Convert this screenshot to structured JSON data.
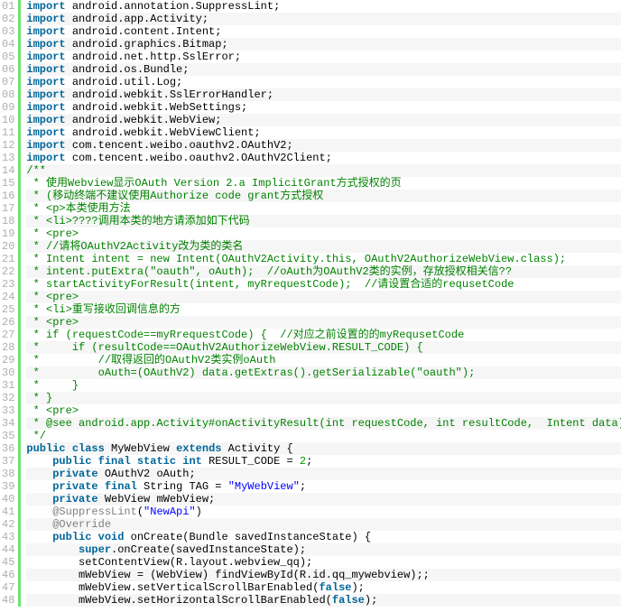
{
  "lines": [
    {
      "n": "01",
      "t": [
        {
          "c": "kw",
          "v": "import"
        },
        {
          "c": "pl",
          "v": " android.annotation.SuppressLint;"
        }
      ]
    },
    {
      "n": "02",
      "t": [
        {
          "c": "kw",
          "v": "import"
        },
        {
          "c": "pl",
          "v": " android.app.Activity;"
        }
      ]
    },
    {
      "n": "03",
      "t": [
        {
          "c": "kw",
          "v": "import"
        },
        {
          "c": "pl",
          "v": " android.content.Intent;"
        }
      ]
    },
    {
      "n": "04",
      "t": [
        {
          "c": "kw",
          "v": "import"
        },
        {
          "c": "pl",
          "v": " android.graphics.Bitmap;"
        }
      ]
    },
    {
      "n": "05",
      "t": [
        {
          "c": "kw",
          "v": "import"
        },
        {
          "c": "pl",
          "v": " android.net.http.SslError;"
        }
      ]
    },
    {
      "n": "06",
      "t": [
        {
          "c": "kw",
          "v": "import"
        },
        {
          "c": "pl",
          "v": " android.os.Bundle;"
        }
      ]
    },
    {
      "n": "07",
      "t": [
        {
          "c": "kw",
          "v": "import"
        },
        {
          "c": "pl",
          "v": " android.util.Log;"
        }
      ]
    },
    {
      "n": "08",
      "t": [
        {
          "c": "kw",
          "v": "import"
        },
        {
          "c": "pl",
          "v": " android.webkit.SslErrorHandler;"
        }
      ]
    },
    {
      "n": "09",
      "t": [
        {
          "c": "kw",
          "v": "import"
        },
        {
          "c": "pl",
          "v": " android.webkit.WebSettings;"
        }
      ]
    },
    {
      "n": "10",
      "t": [
        {
          "c": "kw",
          "v": "import"
        },
        {
          "c": "pl",
          "v": " android.webkit.WebView;"
        }
      ]
    },
    {
      "n": "11",
      "t": [
        {
          "c": "kw",
          "v": "import"
        },
        {
          "c": "pl",
          "v": " android.webkit.WebViewClient;"
        }
      ]
    },
    {
      "n": "12",
      "t": [
        {
          "c": "kw",
          "v": "import"
        },
        {
          "c": "pl",
          "v": " com.tencent.weibo.oauthv2.OAuthV2;"
        }
      ]
    },
    {
      "n": "13",
      "t": [
        {
          "c": "kw",
          "v": "import"
        },
        {
          "c": "pl",
          "v": " com.tencent.weibo.oauthv2.OAuthV2Client;"
        }
      ]
    },
    {
      "n": "14",
      "t": [
        {
          "c": "cm",
          "v": "/**"
        }
      ]
    },
    {
      "n": "15",
      "t": [
        {
          "c": "cm",
          "v": " * 使用Webview显示OAuth Version 2.a ImplicitGrant方式授权的页"
        }
      ]
    },
    {
      "n": "16",
      "t": [
        {
          "c": "cm",
          "v": " * (移动终端不建议使用Authorize code grant方式授权"
        }
      ]
    },
    {
      "n": "17",
      "t": [
        {
          "c": "cm",
          "v": " * <p>本类使用方法"
        }
      ]
    },
    {
      "n": "18",
      "t": [
        {
          "c": "cm",
          "v": " * <li>????调用本类的地方请添加如下代码"
        }
      ]
    },
    {
      "n": "19",
      "t": [
        {
          "c": "cm",
          "v": " * <pre>"
        }
      ]
    },
    {
      "n": "20",
      "t": [
        {
          "c": "cm",
          "v": " * //请将OAuthV2Activity改为类的类名"
        }
      ]
    },
    {
      "n": "21",
      "t": [
        {
          "c": "cm",
          "v": " * Intent intent = new Intent(OAuthV2Activity.this, OAuthV2AuthorizeWebView.class);"
        }
      ]
    },
    {
      "n": "22",
      "t": [
        {
          "c": "cm",
          "v": " * intent.putExtra(\"oauth\", oAuth);  //oAuth为OAuthV2类的实例，存放授权相关信??"
        }
      ]
    },
    {
      "n": "23",
      "t": [
        {
          "c": "cm",
          "v": " * startActivityForResult(intent, myRrequestCode);  //请设置合适的requsetCode"
        }
      ]
    },
    {
      "n": "24",
      "t": [
        {
          "c": "cm",
          "v": " * <pre>"
        }
      ]
    },
    {
      "n": "25",
      "t": [
        {
          "c": "cm",
          "v": " * <li>重写接收回调信息的方"
        }
      ]
    },
    {
      "n": "26",
      "t": [
        {
          "c": "cm",
          "v": " * <pre>"
        }
      ]
    },
    {
      "n": "27",
      "t": [
        {
          "c": "cm",
          "v": " * if (requestCode==myRrequestCode) {  //对应之前设置的的myRequsetCode"
        }
      ]
    },
    {
      "n": "28",
      "t": [
        {
          "c": "cm",
          "v": " *     if (resultCode==OAuthV2AuthorizeWebView.RESULT_CODE) {"
        }
      ]
    },
    {
      "n": "29",
      "t": [
        {
          "c": "cm",
          "v": " *         //取得返回的OAuthV2类实例oAuth"
        }
      ]
    },
    {
      "n": "30",
      "t": [
        {
          "c": "cm",
          "v": " *         oAuth=(OAuthV2) data.getExtras().getSerializable(\"oauth\");"
        }
      ]
    },
    {
      "n": "31",
      "t": [
        {
          "c": "cm",
          "v": " *     }"
        }
      ]
    },
    {
      "n": "32",
      "t": [
        {
          "c": "cm",
          "v": " * }"
        }
      ]
    },
    {
      "n": "33",
      "t": [
        {
          "c": "cm",
          "v": " * <pre>"
        }
      ]
    },
    {
      "n": "34",
      "t": [
        {
          "c": "cm",
          "v": " * @see android.app.Activity#onActivityResult(int requestCode, int resultCode,  Intent data)"
        }
      ]
    },
    {
      "n": "35",
      "t": [
        {
          "c": "cm",
          "v": " */"
        }
      ]
    },
    {
      "n": "36",
      "t": [
        {
          "c": "kw",
          "v": "public"
        },
        {
          "c": "pl",
          "v": " "
        },
        {
          "c": "kw",
          "v": "class"
        },
        {
          "c": "pl",
          "v": " MyWebView "
        },
        {
          "c": "kw",
          "v": "extends"
        },
        {
          "c": "pl",
          "v": " Activity {"
        }
      ]
    },
    {
      "n": "37",
      "t": [
        {
          "c": "pl",
          "v": "    "
        },
        {
          "c": "kw",
          "v": "public"
        },
        {
          "c": "pl",
          "v": " "
        },
        {
          "c": "kw",
          "v": "final"
        },
        {
          "c": "pl",
          "v": " "
        },
        {
          "c": "kw",
          "v": "static"
        },
        {
          "c": "pl",
          "v": " "
        },
        {
          "c": "kw",
          "v": "int"
        },
        {
          "c": "pl",
          "v": " RESULT_CODE = "
        },
        {
          "c": "num",
          "v": "2"
        },
        {
          "c": "pl",
          "v": ";"
        }
      ]
    },
    {
      "n": "38",
      "t": [
        {
          "c": "pl",
          "v": "    "
        },
        {
          "c": "kw",
          "v": "private"
        },
        {
          "c": "pl",
          "v": " OAuthV2 oAuth;"
        }
      ]
    },
    {
      "n": "39",
      "t": [
        {
          "c": "pl",
          "v": "    "
        },
        {
          "c": "kw",
          "v": "private"
        },
        {
          "c": "pl",
          "v": " "
        },
        {
          "c": "kw",
          "v": "final"
        },
        {
          "c": "pl",
          "v": " String TAG = "
        },
        {
          "c": "str",
          "v": "\"MyWebView\""
        },
        {
          "c": "pl",
          "v": ";"
        }
      ]
    },
    {
      "n": "40",
      "t": [
        {
          "c": "pl",
          "v": "    "
        },
        {
          "c": "kw",
          "v": "private"
        },
        {
          "c": "pl",
          "v": " WebView mWebView;"
        }
      ]
    },
    {
      "n": "41",
      "t": [
        {
          "c": "pl",
          "v": "    "
        },
        {
          "c": "ann",
          "v": "@SuppressLint"
        },
        {
          "c": "pl",
          "v": "("
        },
        {
          "c": "str",
          "v": "\"NewApi\""
        },
        {
          "c": "pl",
          "v": ")"
        }
      ]
    },
    {
      "n": "42",
      "t": [
        {
          "c": "pl",
          "v": "    "
        },
        {
          "c": "ann",
          "v": "@Override"
        }
      ]
    },
    {
      "n": "43",
      "t": [
        {
          "c": "pl",
          "v": "    "
        },
        {
          "c": "kw",
          "v": "public"
        },
        {
          "c": "pl",
          "v": " "
        },
        {
          "c": "kw",
          "v": "void"
        },
        {
          "c": "pl",
          "v": " onCreate(Bundle savedInstanceState) {"
        }
      ]
    },
    {
      "n": "44",
      "t": [
        {
          "c": "pl",
          "v": "        "
        },
        {
          "c": "kw",
          "v": "super"
        },
        {
          "c": "pl",
          "v": ".onCreate(savedInstanceState);"
        }
      ]
    },
    {
      "n": "45",
      "t": [
        {
          "c": "pl",
          "v": "        setContentView(R.layout.webview_qq);"
        }
      ]
    },
    {
      "n": "46",
      "t": [
        {
          "c": "pl",
          "v": "        mWebView = (WebView) findViewById(R.id.qq_mywebview);;"
        }
      ]
    },
    {
      "n": "47",
      "t": [
        {
          "c": "pl",
          "v": "        mWebView.setVerticalScrollBarEnabled("
        },
        {
          "c": "kw",
          "v": "false"
        },
        {
          "c": "pl",
          "v": ");"
        }
      ]
    },
    {
      "n": "48",
      "t": [
        {
          "c": "pl",
          "v": "        mWebView.setHorizontalScrollBarEnabled("
        },
        {
          "c": "kw",
          "v": "false"
        },
        {
          "c": "pl",
          "v": ");"
        }
      ]
    }
  ]
}
